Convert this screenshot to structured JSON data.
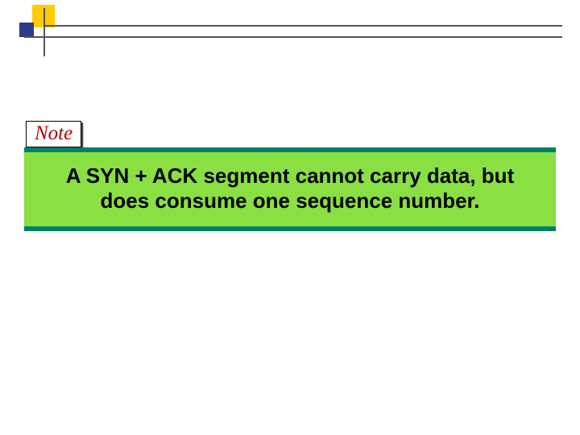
{
  "colors": {
    "accent_yellow": "#ffcc00",
    "accent_blue": "#2e3a8a",
    "rule_gray": "#555555",
    "note_text": "#b00000",
    "callout_bar": "#00806b",
    "callout_bg": "#8adf43"
  },
  "note": {
    "label": "Note"
  },
  "callout": {
    "text": "A SYN + ACK segment cannot carry data, but does consume one sequence number."
  }
}
